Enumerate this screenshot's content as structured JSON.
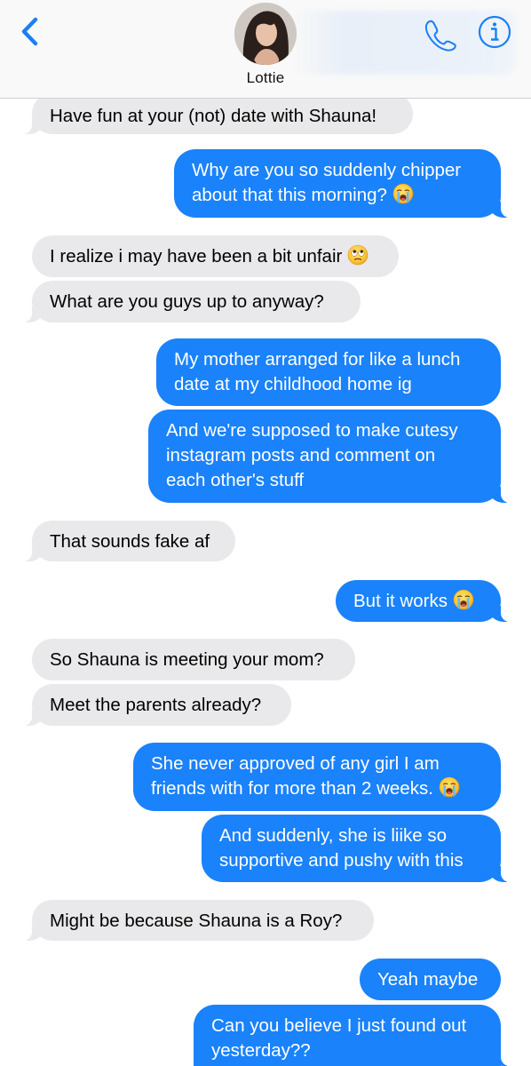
{
  "header": {
    "contact_name": "Lottie",
    "back_icon": "chevron-left-icon",
    "phone_icon": "phone-icon",
    "info_icon": "info-icon",
    "accent_color": "#1a7ff5"
  },
  "colors": {
    "sent_bubble": "#1a82fb",
    "received_bubble": "#e9e9eb"
  },
  "messages": [
    {
      "from": "them",
      "text": "Have fun at your (not) date with Shauna!"
    },
    {
      "from": "me",
      "lines": [
        "Why are you so suddenly chipper",
        "about that this morning?"
      ],
      "emoji": "loudly-crying-face"
    },
    {
      "from": "them",
      "text": "I realize i may have been a bit unfair",
      "emoji": "face-with-rolling-eyes"
    },
    {
      "from": "them",
      "text": "What are you guys up to anyway?"
    },
    {
      "from": "me",
      "lines": [
        "My mother arranged for like a lunch",
        "date at my childhood home ig"
      ]
    },
    {
      "from": "me",
      "lines": [
        "And we're supposed to make cutesy",
        "instagram posts and comment on",
        "each other's stuff"
      ]
    },
    {
      "from": "them",
      "text": "That sounds fake af"
    },
    {
      "from": "me",
      "text": "But it works",
      "emoji": "loudly-crying-face"
    },
    {
      "from": "them",
      "text": "So Shauna is meeting your mom?"
    },
    {
      "from": "them",
      "text": "Meet the parents already?"
    },
    {
      "from": "me",
      "lines": [
        "She never approved of any girl I am",
        "friends with for more than 2 weeks."
      ],
      "emoji": "loudly-crying-face"
    },
    {
      "from": "me",
      "lines": [
        "And suddenly, she is liike so",
        "supportive and pushy with this"
      ]
    },
    {
      "from": "them",
      "text": "Might be because Shauna is a Roy?"
    },
    {
      "from": "me",
      "text": "Yeah maybe"
    },
    {
      "from": "me",
      "lines": [
        "Can you believe I just found out",
        "yesterday??"
      ]
    }
  ]
}
